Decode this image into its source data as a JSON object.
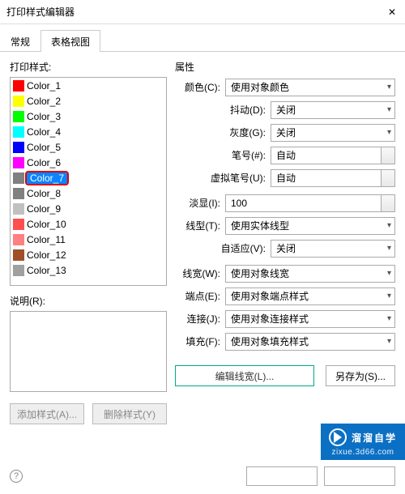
{
  "window": {
    "title": "打印样式编辑器"
  },
  "tabs": {
    "general": "常规",
    "table": "表格视图"
  },
  "left": {
    "label": "打印样式:",
    "items": [
      {
        "name": "Color_1",
        "color": "#ff0000"
      },
      {
        "name": "Color_2",
        "color": "#ffff00"
      },
      {
        "name": "Color_3",
        "color": "#00ff00"
      },
      {
        "name": "Color_4",
        "color": "#00ffff"
      },
      {
        "name": "Color_5",
        "color": "#0000ff"
      },
      {
        "name": "Color_6",
        "color": "#ff00ff"
      },
      {
        "name": "Color_7",
        "color": "#808080",
        "selected": true
      },
      {
        "name": "Color_8",
        "color": "#808080"
      },
      {
        "name": "Color_9",
        "color": "#c0c0c0"
      },
      {
        "name": "Color_10",
        "color": "#ff5050"
      },
      {
        "name": "Color_11",
        "color": "#ff8080"
      },
      {
        "name": "Color_12",
        "color": "#a05028"
      },
      {
        "name": "Color_13",
        "color": "#a0a0a0"
      }
    ],
    "desc_label": "说明(R):",
    "add_btn": "添加样式(A)...",
    "del_btn": "删除样式(Y)"
  },
  "props": {
    "section": "属性",
    "color_label": "颜色(C):",
    "color_val": "使用对象颜色",
    "dither_label": "抖动(D):",
    "dither_val": "关闭",
    "gray_label": "灰度(G):",
    "gray_val": "关闭",
    "pen_label": "笔号(#):",
    "pen_val": "自动",
    "vpen_label": "虚拟笔号(U):",
    "vpen_val": "自动",
    "shade_label": "淡显(I):",
    "shade_val": "100",
    "ltype_label": "线型(T):",
    "ltype_val": "使用实体线型",
    "adapt_label": "自适应(V):",
    "adapt_val": "关闭",
    "lw_label": "线宽(W):",
    "lw_val": "使用对象线宽",
    "end_label": "端点(E):",
    "end_val": "使用对象端点样式",
    "join_label": "连接(J):",
    "join_val": "使用对象连接样式",
    "fill_label": "填充(F):",
    "fill_val": "使用对象填充样式",
    "edit_lw": "编辑线宽(L)...",
    "save_as": "另存为(S)..."
  },
  "footer": {
    "ok": "",
    "cancel": ""
  },
  "watermark": {
    "brand": "溜溜自学",
    "url": "zixue.3d66.com"
  }
}
